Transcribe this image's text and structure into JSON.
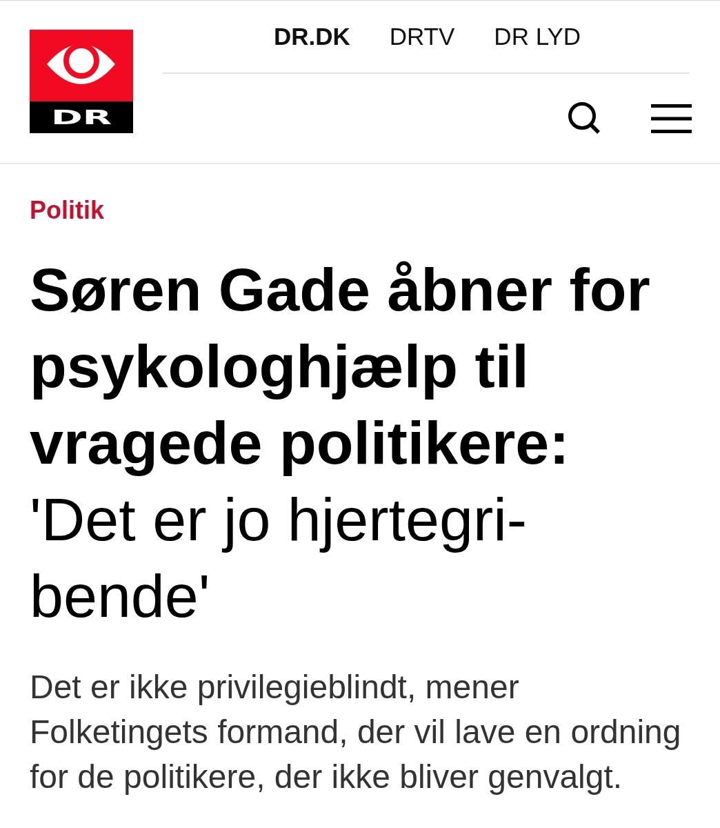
{
  "header": {
    "logo": {
      "text": "DR"
    },
    "nav": [
      {
        "label": "DR.DK",
        "selected": true
      },
      {
        "label": "DRTV",
        "selected": false
      },
      {
        "label": "DR LYD",
        "selected": false
      }
    ]
  },
  "article": {
    "category": "Politik",
    "headline": "**Søren Gade åbner for psykologhjælp til vragede politikere:** 'Det er jo hjertegri-bende'",
    "lead": "Det er ikke privilegieblindt, mener Folketingets formand, der vil lave en ordning for de politikere, der ikke bliver genvalgt."
  }
}
